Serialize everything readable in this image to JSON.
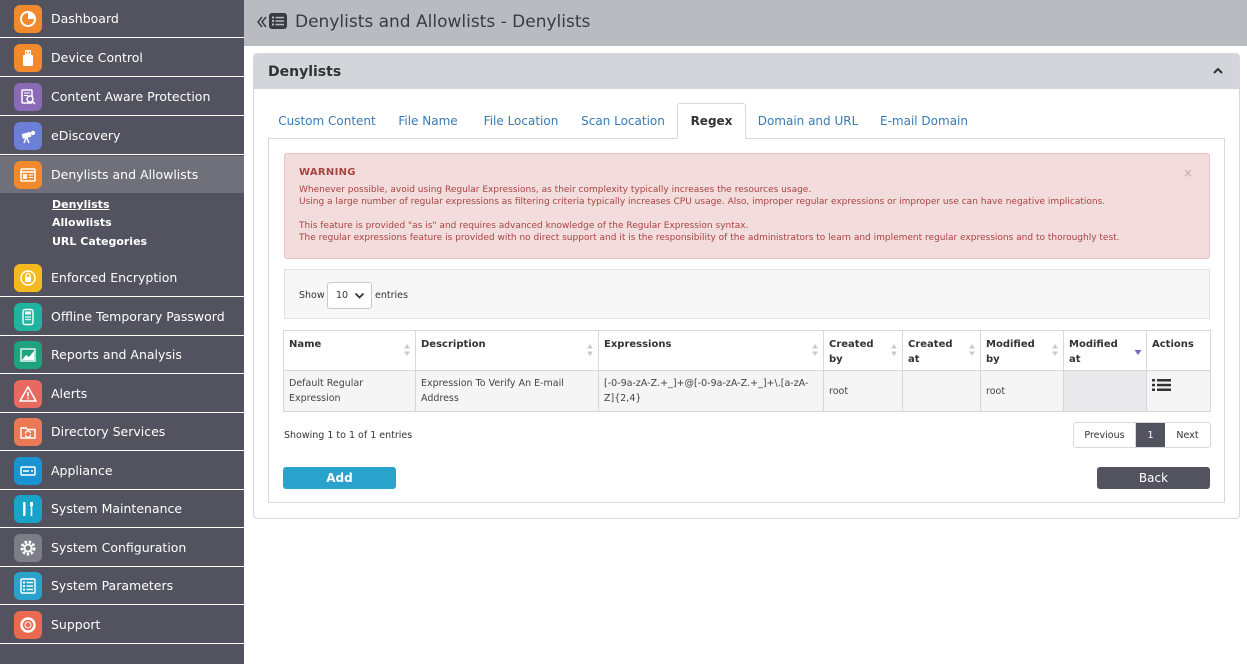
{
  "colors": {
    "sidebar_bg": "#52535e",
    "sidebar_active": "#6f7079",
    "topbar_bg": "#babbc0",
    "panel_header_bg": "#d3d5db",
    "link": "#3a7ab3",
    "warning_bg": "#f2dcdc",
    "warning_text": "#a94442",
    "add_button": "#2aa3cc",
    "back_button": "#52535e"
  },
  "sidebar": {
    "items": [
      {
        "label": "Dashboard",
        "icon": "dashboard-icon",
        "color": "#f08a2c"
      },
      {
        "label": "Device Control",
        "icon": "usb-icon",
        "color": "#f08a2c"
      },
      {
        "label": "Content Aware Protection",
        "icon": "document-search-icon",
        "color": "#8b6bb8"
      },
      {
        "label": "eDiscovery",
        "icon": "telescope-icon",
        "color": "#6b7fd6"
      },
      {
        "label": "Denylists and Allowlists",
        "icon": "list-window-icon",
        "color": "#f08a2c"
      },
      {
        "label": "Enforced Encryption",
        "icon": "lock-icon",
        "color": "#f5b920"
      },
      {
        "label": "Offline Temporary Password",
        "icon": "keypad-icon",
        "color": "#1fb3a0"
      },
      {
        "label": "Reports and Analysis",
        "icon": "chart-icon",
        "color": "#1fa37e"
      },
      {
        "label": "Alerts",
        "icon": "warning-icon",
        "color": "#e66a60"
      },
      {
        "label": "Directory Services",
        "icon": "folder-sync-icon",
        "color": "#e97a55"
      },
      {
        "label": "Appliance",
        "icon": "server-icon",
        "color": "#1a93d1"
      },
      {
        "label": "System Maintenance",
        "icon": "tools-icon",
        "color": "#1aa3c8"
      },
      {
        "label": "System Configuration",
        "icon": "gear-icon",
        "color": "#7c7d86"
      },
      {
        "label": "System Parameters",
        "icon": "list-icon",
        "color": "#2aa3cc"
      },
      {
        "label": "Support",
        "icon": "lifebuoy-icon",
        "color": "#e96a50"
      }
    ],
    "sub_items": [
      {
        "label": "Denylists"
      },
      {
        "label": "Allowlists"
      },
      {
        "label": "URL Categories"
      }
    ]
  },
  "header": {
    "title": "Denylists and Allowlists - Denylists"
  },
  "panel": {
    "title": "Denylists"
  },
  "tabs": [
    {
      "label": "Custom Content"
    },
    {
      "label": "File Name"
    },
    {
      "label": "File Location"
    },
    {
      "label": "Scan Location"
    },
    {
      "label": "Regex"
    },
    {
      "label": "Domain and URL"
    },
    {
      "label": "E-mail Domain"
    }
  ],
  "warning": {
    "title": "WARNING",
    "line1": "Whenever possible, avoid using Regular Expressions, as their complexity typically increases the resources usage.",
    "line2": "Using a large number of regular expressions as filtering criteria typically increases CPU usage. Also, improper regular expressions or improper use can have negative implications.",
    "line3": "This feature is provided \"as is\" and requires advanced knowledge of the Regular Expression syntax.",
    "line4": "The regular expressions feature is provided with no direct support and it is the responsibility of the administrators to learn and implement regular expressions and to thoroughly test.",
    "close": "×"
  },
  "length_control": {
    "show": "Show",
    "value": "10",
    "entries": "entries"
  },
  "table": {
    "columns": [
      {
        "label": "Name"
      },
      {
        "label": "Description"
      },
      {
        "label": "Expressions"
      },
      {
        "label": "Created by"
      },
      {
        "label": "Created at"
      },
      {
        "label": "Modified by"
      },
      {
        "label": "Modified at"
      },
      {
        "label": "Actions"
      }
    ],
    "rows": [
      {
        "name": "Default Regular Expression",
        "description": "Expression To Verify An E-mail Address",
        "expressions": "[-0-9a-zA-Z.+_]+@[-0-9a-zA-Z.+_]+\\.[a-zA-Z]{2,4}",
        "created_by": "root",
        "created_at": "",
        "modified_by": "root",
        "modified_at": ""
      }
    ],
    "info": "Showing 1 to 1 of 1 entries"
  },
  "pagination": {
    "previous": "Previous",
    "current": "1",
    "next": "Next"
  },
  "buttons": {
    "add": "Add",
    "back": "Back"
  }
}
